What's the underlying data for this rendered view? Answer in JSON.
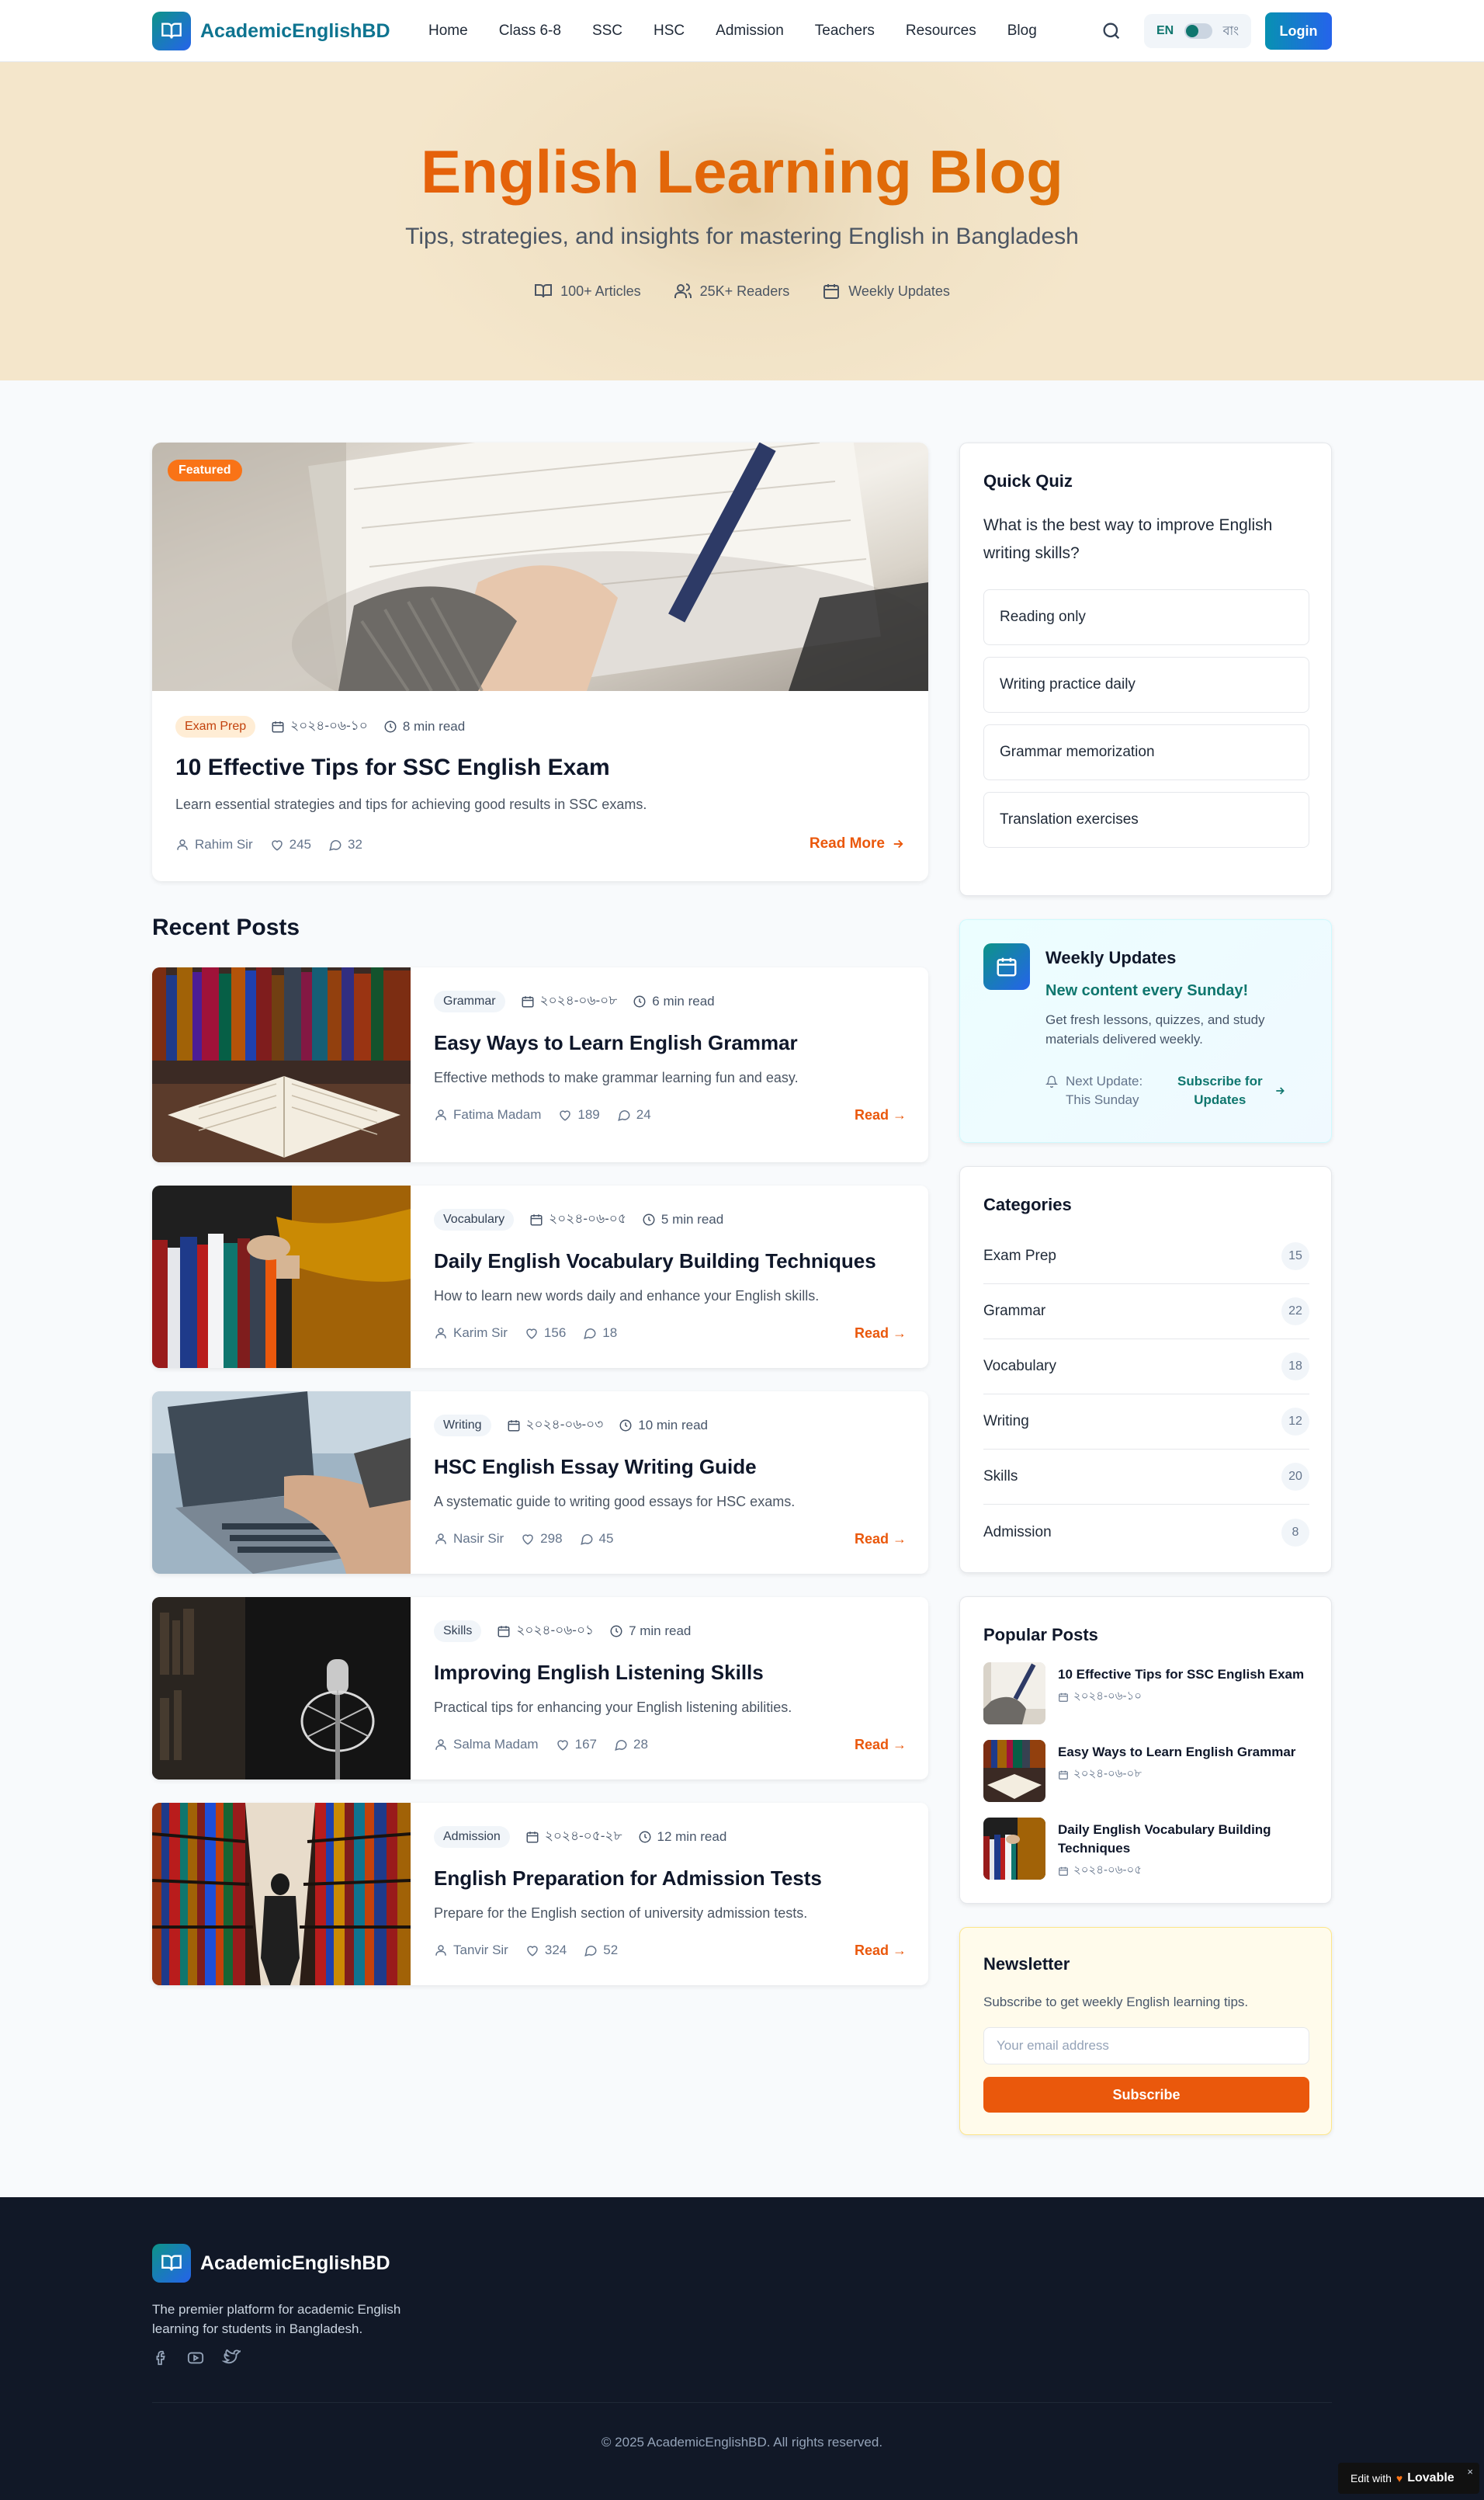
{
  "nav": {
    "brand": "AcademicEnglishBD",
    "items": [
      "Home",
      "Class 6-8",
      "SSC",
      "HSC",
      "Admission",
      "Teachers",
      "Resources",
      "Blog"
    ],
    "lang_en": "EN",
    "lang_bn": "বাং",
    "login": "Login"
  },
  "hero": {
    "title": "English Learning Blog",
    "subtitle": "Tips, strategies, and insights for mastering English in Bangladesh",
    "stats": [
      "100+ Articles",
      "25K+ Readers",
      "Weekly Updates"
    ]
  },
  "featured": {
    "badge": "Featured",
    "category": "Exam Prep",
    "date": "২০২৪-০৬-১০",
    "read_time": "8 min read",
    "title": "10 Effective Tips for SSC English Exam",
    "desc": "Learn essential strategies and tips for achieving good results in SSC exams.",
    "author": "Rahim Sir",
    "likes": "245",
    "comments": "32",
    "read_more": "Read More"
  },
  "recent": {
    "heading": "Recent Posts",
    "posts": [
      {
        "category": "Grammar",
        "date": "২০২৪-০৬-০৮",
        "read_time": "6 min read",
        "title": "Easy Ways to Learn English Grammar",
        "desc": "Effective methods to make grammar learning fun and easy.",
        "author": "Fatima Madam",
        "likes": "189",
        "comments": "24",
        "read": "Read →"
      },
      {
        "category": "Vocabulary",
        "date": "২০২৪-০৬-০৫",
        "read_time": "5 min read",
        "title": "Daily English Vocabulary Building Techniques",
        "desc": "How to learn new words daily and enhance your English skills.",
        "author": "Karim Sir",
        "likes": "156",
        "comments": "18",
        "read": "Read →"
      },
      {
        "category": "Writing",
        "date": "২০২৪-০৬-০৩",
        "read_time": "10 min read",
        "title": "HSC English Essay Writing Guide",
        "desc": "A systematic guide to writing good essays for HSC exams.",
        "author": "Nasir Sir",
        "likes": "298",
        "comments": "45",
        "read": "Read →"
      },
      {
        "category": "Skills",
        "date": "২০২৪-০৬-০১",
        "read_time": "7 min read",
        "title": "Improving English Listening Skills",
        "desc": "Practical tips for enhancing your English listening abilities.",
        "author": "Salma Madam",
        "likes": "167",
        "comments": "28",
        "read": "Read →"
      },
      {
        "category": "Admission",
        "date": "২০২৪-০৫-২৮",
        "read_time": "12 min read",
        "title": "English Preparation for Admission Tests",
        "desc": "Prepare for the English section of university admission tests.",
        "author": "Tanvir Sir",
        "likes": "324",
        "comments": "52",
        "read": "Read →"
      }
    ]
  },
  "quiz": {
    "title": "Quick Quiz",
    "question": "What is the best way to improve English writing skills?",
    "options": [
      "Reading only",
      "Writing practice daily",
      "Grammar memorization",
      "Translation exercises"
    ]
  },
  "weekly": {
    "title": "Weekly Updates",
    "headline": "New content every Sunday!",
    "desc": "Get fresh lessons, quizzes, and study materials delivered weekly.",
    "next_label": "Next Update:",
    "next_value": "This Sunday",
    "subscribe_line1": "Subscribe for",
    "subscribe_line2": "Updates"
  },
  "categories": {
    "title": "Categories",
    "items": [
      {
        "name": "Exam Prep",
        "count": "15"
      },
      {
        "name": "Grammar",
        "count": "22"
      },
      {
        "name": "Vocabulary",
        "count": "18"
      },
      {
        "name": "Writing",
        "count": "12"
      },
      {
        "name": "Skills",
        "count": "20"
      },
      {
        "name": "Admission",
        "count": "8"
      }
    ]
  },
  "popular": {
    "title": "Popular Posts",
    "items": [
      {
        "title": "10 Effective Tips for SSC English Exam",
        "date": "২০২৪-০৬-১০"
      },
      {
        "title": "Easy Ways to Learn English Grammar",
        "date": "২০২৪-০৬-০৮"
      },
      {
        "title": "Daily English Vocabulary Building Techniques",
        "date": "২০২৪-০৬-০৫"
      }
    ]
  },
  "newsletter": {
    "title": "Newsletter",
    "desc": "Subscribe to get weekly English learning tips.",
    "placeholder": "Your email address",
    "button": "Subscribe"
  },
  "footer": {
    "brand": "AcademicEnglishBD",
    "desc": "The premier platform for academic English learning for students in Bangladesh.",
    "social": [
      "facebook-icon",
      "youtube-icon",
      "twitter-icon"
    ],
    "copyright": "© 2025 AcademicEnglishBD. All rights reserved."
  },
  "badge": {
    "prefix": "Edit with",
    "brand": "Lovable",
    "close": "×"
  },
  "colors": {
    "accent": "#ea580c",
    "brand": "#0e7490",
    "teal": "#0f766e",
    "footer_bg": "#111827"
  }
}
